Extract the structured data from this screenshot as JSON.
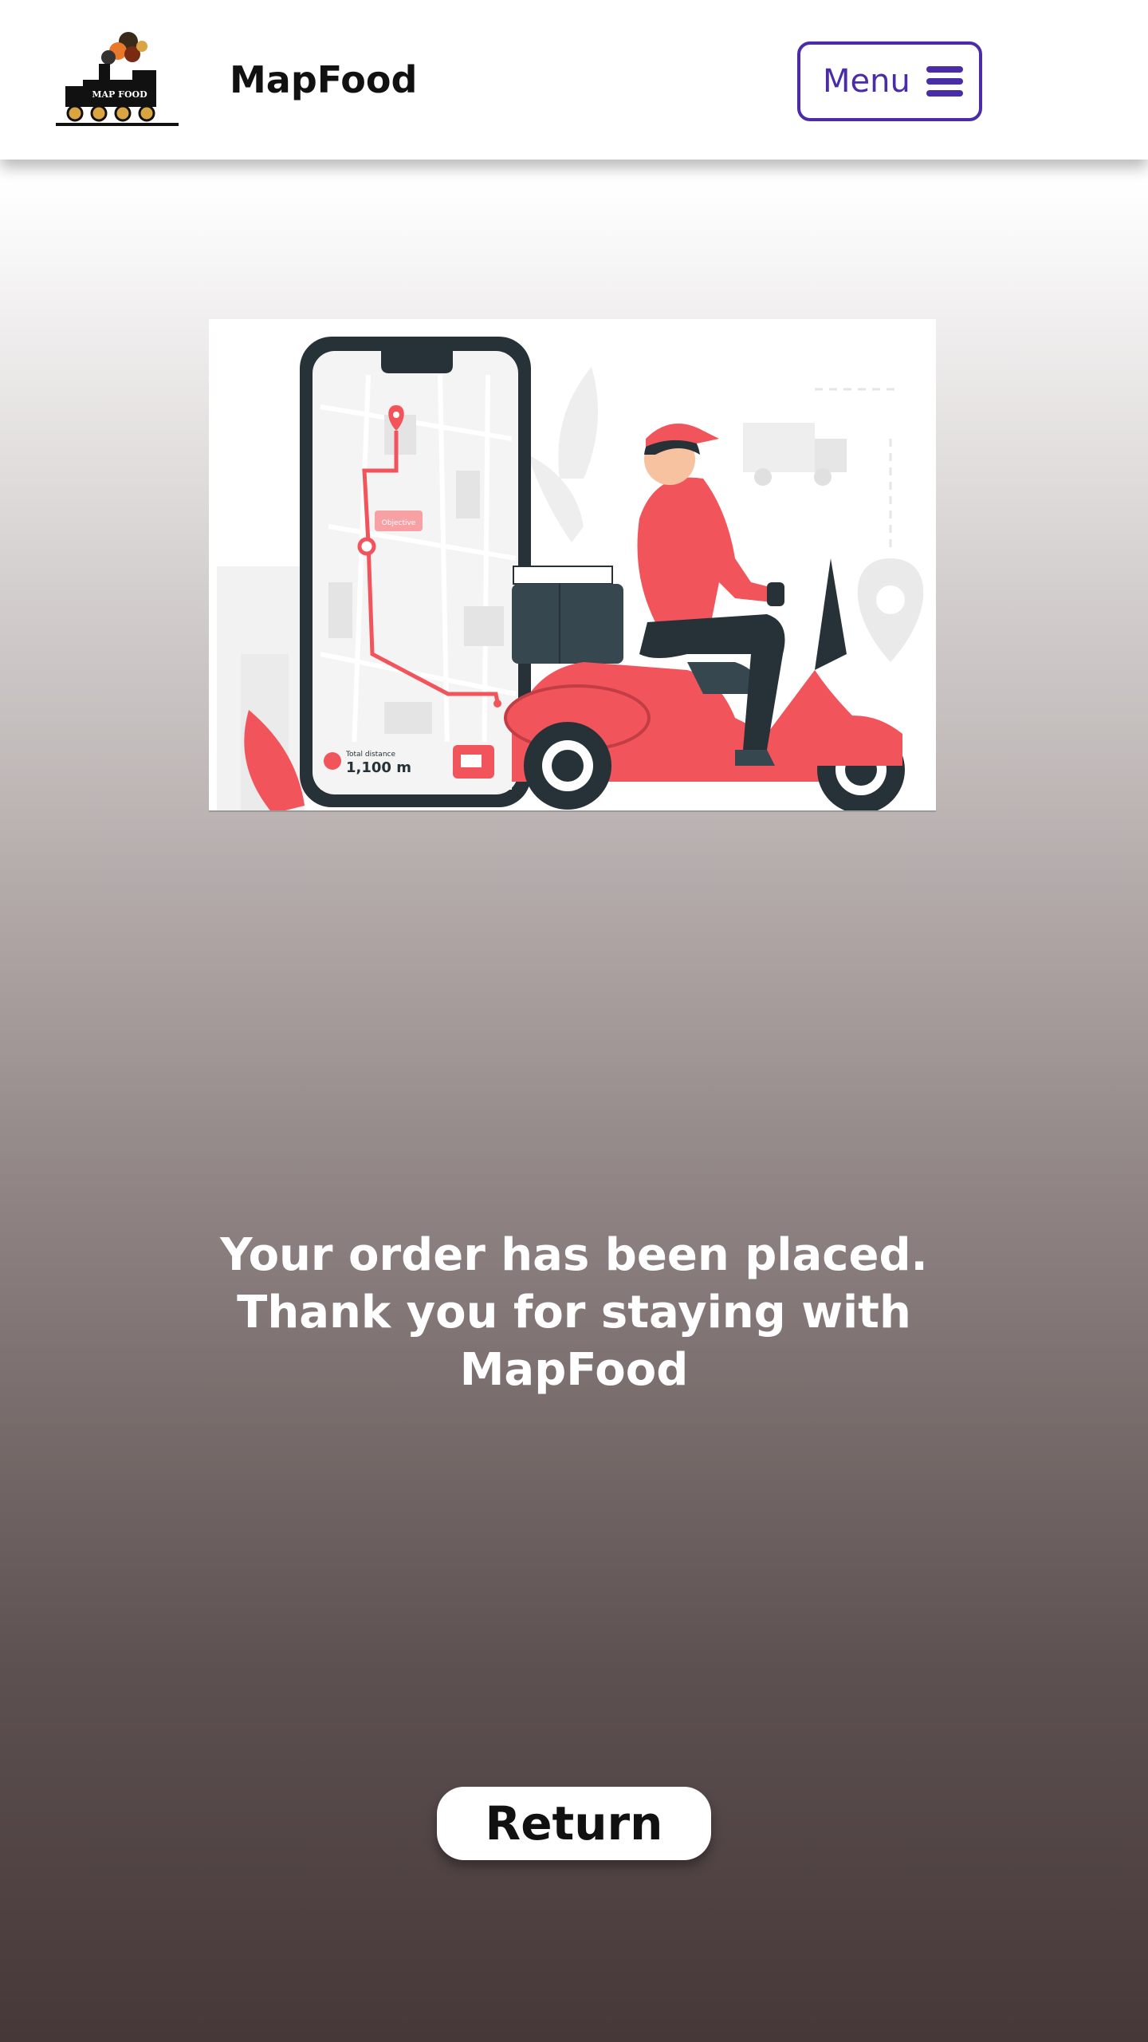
{
  "header": {
    "logo_icon": "train-logo-icon",
    "logo_text": "MAP FOOD",
    "brand": "MapFood",
    "menu_label": "Menu",
    "menu_icon": "hamburger-icon",
    "accent_color": "#4a2da6"
  },
  "hero": {
    "description_icon": "delivery-scooter-illustration",
    "map_tooltip": "Objective",
    "distance_label": "Total distance",
    "distance_value": "1,100 m",
    "accent_color": "#f2545b"
  },
  "main": {
    "message": "Your order has been placed. Thank you for staying with MapFood"
  },
  "actions": {
    "return_label": "Return"
  }
}
